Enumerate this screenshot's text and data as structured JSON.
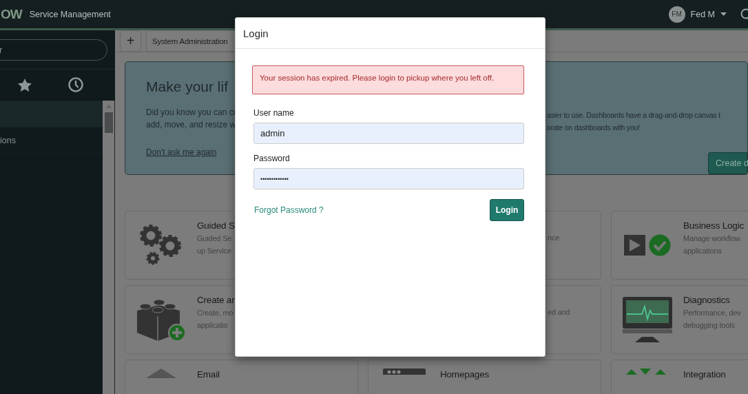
{
  "header": {
    "logo": "OW",
    "product": "Service Management",
    "user": {
      "initials": "FM",
      "name": "Fed M"
    }
  },
  "sidebar": {
    "filter": {
      "placeholder": "r"
    },
    "items": [
      {
        "selected": true
      },
      {
        "label": "ions",
        "selected": false
      }
    ]
  },
  "toolbar": {
    "add_button": "+",
    "tab": "System Administration"
  },
  "banner": {
    "title": "Make your lif",
    "left_lines": [
      "Did you know you can cr",
      "add, move, and resize w"
    ],
    "link": "Don't ask me again",
    "right_lines": [
      "asier to use. Dashboards have a drag-and-drop canvas t",
      "orate on dashboards with you!"
    ],
    "button": "Create d"
  },
  "cards": [
    {
      "kind": "gears",
      "title": "Guided S",
      "description": [
        "Guided Se",
        "up Service"
      ]
    },
    {
      "kind": "covered",
      "description": [
        "nce"
      ]
    },
    {
      "kind": "workflow",
      "title": "Business Logic",
      "description": [
        "Manage workflow",
        "applications"
      ]
    },
    {
      "kind": "blocks",
      "title": "Create ar",
      "description": [
        "Create, mo",
        "applicatio"
      ]
    },
    {
      "kind": "covered",
      "description": [
        "ed and"
      ]
    },
    {
      "kind": "monitor",
      "title": "Diagnostics",
      "description": [
        "Performance, dev",
        "debugging tools"
      ]
    },
    {
      "kind": "envelope",
      "title": "Email"
    },
    {
      "kind": "homepages",
      "title": "Homepages"
    },
    {
      "kind": "integration",
      "title": "Integration"
    }
  ],
  "modal": {
    "title": "Login",
    "alert": "Your session has expired. Please login to pickup where you left off.",
    "fields": [
      {
        "kind": "text",
        "label": "User name",
        "value": "admin"
      },
      {
        "kind": "password",
        "label": "Password",
        "value": "•••••••••••••"
      }
    ],
    "forgot_link": "Forgot Password ?",
    "submit": "Login"
  }
}
